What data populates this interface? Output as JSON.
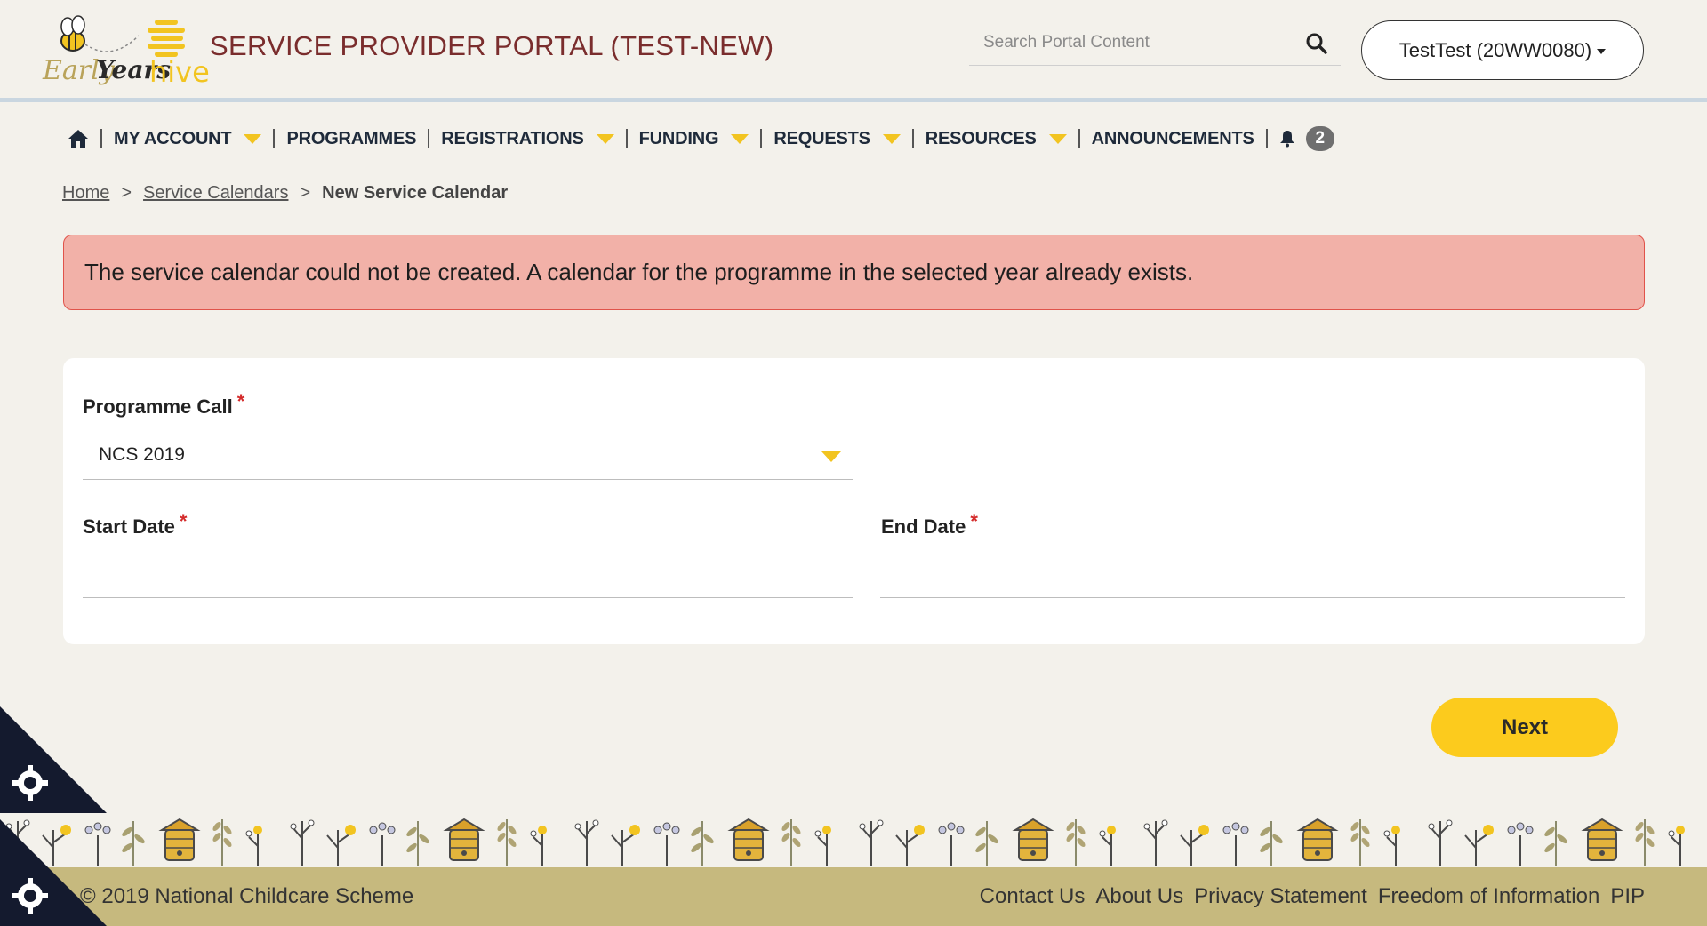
{
  "header": {
    "logo": {
      "part1": "Early",
      "part2": "Years",
      "part3": "hive"
    },
    "portal_title": "SERVICE PROVIDER PORTAL (TEST-NEW)",
    "search_placeholder": "Search Portal Content",
    "user_label": "TestTest (20WW0080)"
  },
  "nav": {
    "items": [
      {
        "label": "MY ACCOUNT",
        "dropdown": true
      },
      {
        "label": "PROGRAMMES",
        "dropdown": false
      },
      {
        "label": "REGISTRATIONS",
        "dropdown": true
      },
      {
        "label": "FUNDING",
        "dropdown": true
      },
      {
        "label": "REQUESTS",
        "dropdown": true
      },
      {
        "label": "RESOURCES",
        "dropdown": true
      },
      {
        "label": "ANNOUNCEMENTS",
        "dropdown": false
      }
    ],
    "notification_count": "2"
  },
  "breadcrumb": {
    "home": "Home",
    "service_calendars": "Service Calendars",
    "current": "New Service Calendar",
    "separator": ">"
  },
  "alert": {
    "message": "The service calendar could not be created. A calendar for the programme in the selected year already exists."
  },
  "form": {
    "programme_call_label": "Programme Call",
    "programme_call_value": "NCS 2019",
    "start_date_label": "Start Date",
    "start_date_value": "",
    "end_date_label": "End Date",
    "end_date_value": "",
    "required_marker": "*"
  },
  "actions": {
    "next_label": "Next"
  },
  "footer": {
    "copyright": "© 2019 National Childcare Scheme",
    "links": [
      "Contact Us",
      "About Us",
      "Privacy Statement",
      "Freedom of Information",
      "PIP"
    ]
  },
  "colors": {
    "background": "#f3f1eb",
    "title": "#7a2d2d",
    "accent_yellow": "#fccb1d",
    "alert_bg": "#f2b1a8",
    "alert_border": "#e0534a",
    "footer_bg": "#c6b97e"
  },
  "icons": [
    "bee-logo-icon",
    "search-icon",
    "home-icon",
    "bell-icon",
    "cookie-settings-icon"
  ]
}
